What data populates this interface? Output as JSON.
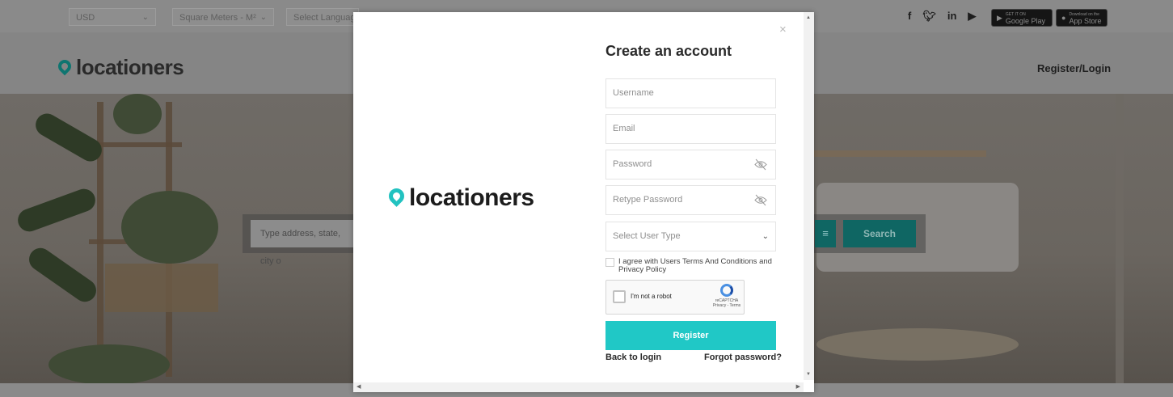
{
  "top_bar": {
    "currency": "USD",
    "units": "Square Meters - M²",
    "language": "Select Language",
    "social_icons": [
      "facebook-icon",
      "twitter-icon",
      "linkedin-icon",
      "youtube-icon"
    ],
    "google_play": {
      "small": "GET IT ON",
      "label": "Google Play"
    },
    "app_store": {
      "small": "Download on the",
      "label": "App Store"
    }
  },
  "header": {
    "logo_text": "locationers",
    "register_login": "Register/Login"
  },
  "hero_search": {
    "placeholder": "Type address, state, city o",
    "search_label": "Search"
  },
  "modal": {
    "close": "×",
    "logo_text": "locationers",
    "title": "Create an account",
    "fields": {
      "username": "Username",
      "email": "Email",
      "password": "Password",
      "retype_password": "Retype Password",
      "user_type": "Select User Type"
    },
    "agree_text": "I agree with Users Terms And Conditions and Privacy Policy",
    "recaptcha": {
      "label": "I'm not a robot",
      "brand": "reCAPTCHA",
      "links": "Privacy - Terms"
    },
    "register_label": "Register",
    "back_to_login": "Back to login",
    "forgot_password": "Forgot password?"
  },
  "colors": {
    "accent": "#20c8c6",
    "accent_dark": "#0e7570"
  }
}
